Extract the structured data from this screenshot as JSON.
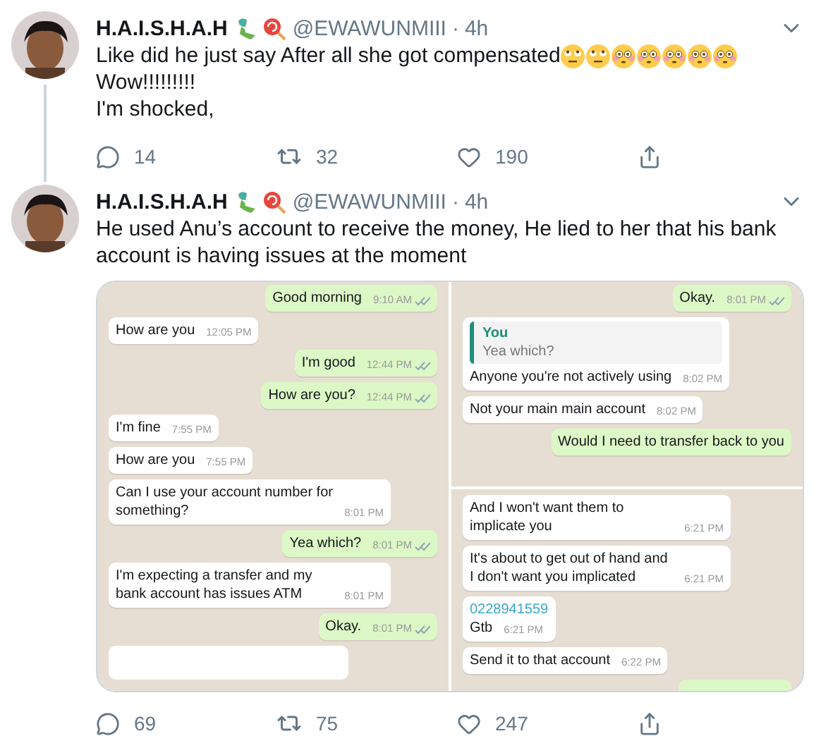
{
  "tweets": [
    {
      "author": {
        "name": "H.A.I.S.H.A.H",
        "badges": [
          {
            "kind": "mermaid"
          },
          {
            "kind": "lollipop"
          }
        ],
        "handle": "@EWAWUNMIII",
        "separator": "·",
        "time": "4h"
      },
      "body": [
        {
          "text": "Like did he just say After all she got compensated",
          "emojis": [
            {
              "kind": "rolling-eyes"
            },
            {
              "kind": "rolling-eyes"
            },
            {
              "kind": "flushed"
            },
            {
              "kind": "flushed"
            },
            {
              "kind": "flushed"
            },
            {
              "kind": "flushed"
            },
            {
              "kind": "flushed"
            }
          ]
        },
        {
          "text": "Wow!!!!!!!!!"
        },
        {
          "text": "I'm shocked,"
        }
      ],
      "actions": {
        "replies": "14",
        "retweets": "32",
        "likes": "190"
      }
    },
    {
      "author": {
        "name": "H.A.I.S.H.A.H",
        "badges": [
          {
            "kind": "mermaid"
          },
          {
            "kind": "lollipop"
          }
        ],
        "handle": "@EWAWUNMIII",
        "separator": "·",
        "time": "4h"
      },
      "body": [
        {
          "text": "He used Anu’s account to receive the money, He lied to her that his bank account is having issues at the moment"
        }
      ],
      "media": {
        "kind": "chat-screenshots",
        "panels": [
          {
            "messages": [
              {
                "kind": "text",
                "sent": true,
                "text": "Good morning",
                "time": "9:10 AM",
                "read": true
              },
              {
                "kind": "text",
                "sent": false,
                "text": "How are you",
                "time": "12:05 PM"
              },
              {
                "kind": "text",
                "sent": true,
                "text": "I'm good",
                "time": "12:44 PM",
                "read": true
              },
              {
                "kind": "text",
                "sent": true,
                "text": "How are you?",
                "time": "12:44 PM",
                "read": true
              },
              {
                "kind": "text",
                "sent": false,
                "text": "I'm fine",
                "time": "7:55 PM"
              },
              {
                "kind": "text",
                "sent": false,
                "text": "How are you",
                "time": "7:55 PM"
              },
              {
                "kind": "text",
                "sent": false,
                "text": "Can I use your account number for something?",
                "time": "8:01 PM"
              },
              {
                "kind": "text",
                "sent": true,
                "text": "Yea which?",
                "time": "8:01 PM",
                "read": true
              },
              {
                "kind": "text",
                "sent": false,
                "text": "I'm expecting a transfer and my bank account has issues ATM",
                "time": "8:01 PM"
              },
              {
                "kind": "text",
                "sent": true,
                "text": "Okay.",
                "time": "8:01 PM",
                "read": true
              },
              {
                "kind": "stub",
                "sent": false
              }
            ]
          },
          {
            "messages": [
              {
                "kind": "text",
                "sent": true,
                "text": "Okay.",
                "time": "8:01 PM",
                "read": true
              },
              {
                "kind": "reply",
                "sent": false,
                "quote": {
                  "author": "You",
                  "text": "Yea which?"
                },
                "text": "Anyone you're not actively using",
                "time": "8:02 PM"
              },
              {
                "kind": "text",
                "sent": false,
                "text": "Not your main main account",
                "time": "8:02 PM"
              },
              {
                "kind": "cut",
                "sent": true,
                "text": "Would I need to transfer back to you"
              }
            ]
          },
          {
            "messages": [
              {
                "kind": "text",
                "sent": false,
                "text": "And I won't want them to implicate you",
                "time": "6:21 PM"
              },
              {
                "kind": "text",
                "sent": false,
                "text": "It's about to get out of hand and I don't want you implicated",
                "time": "6:21 PM"
              },
              {
                "kind": "link",
                "sent": false,
                "link": "0228941559",
                "text": "Gtb",
                "time": "6:21 PM"
              },
              {
                "kind": "text",
                "sent": false,
                "text": "Send it to that account",
                "time": "6:22 PM"
              },
              {
                "kind": "stub",
                "sent": true
              }
            ]
          }
        ]
      },
      "actions": {
        "replies": "69",
        "retweets": "75",
        "likes": "247"
      }
    }
  ]
}
